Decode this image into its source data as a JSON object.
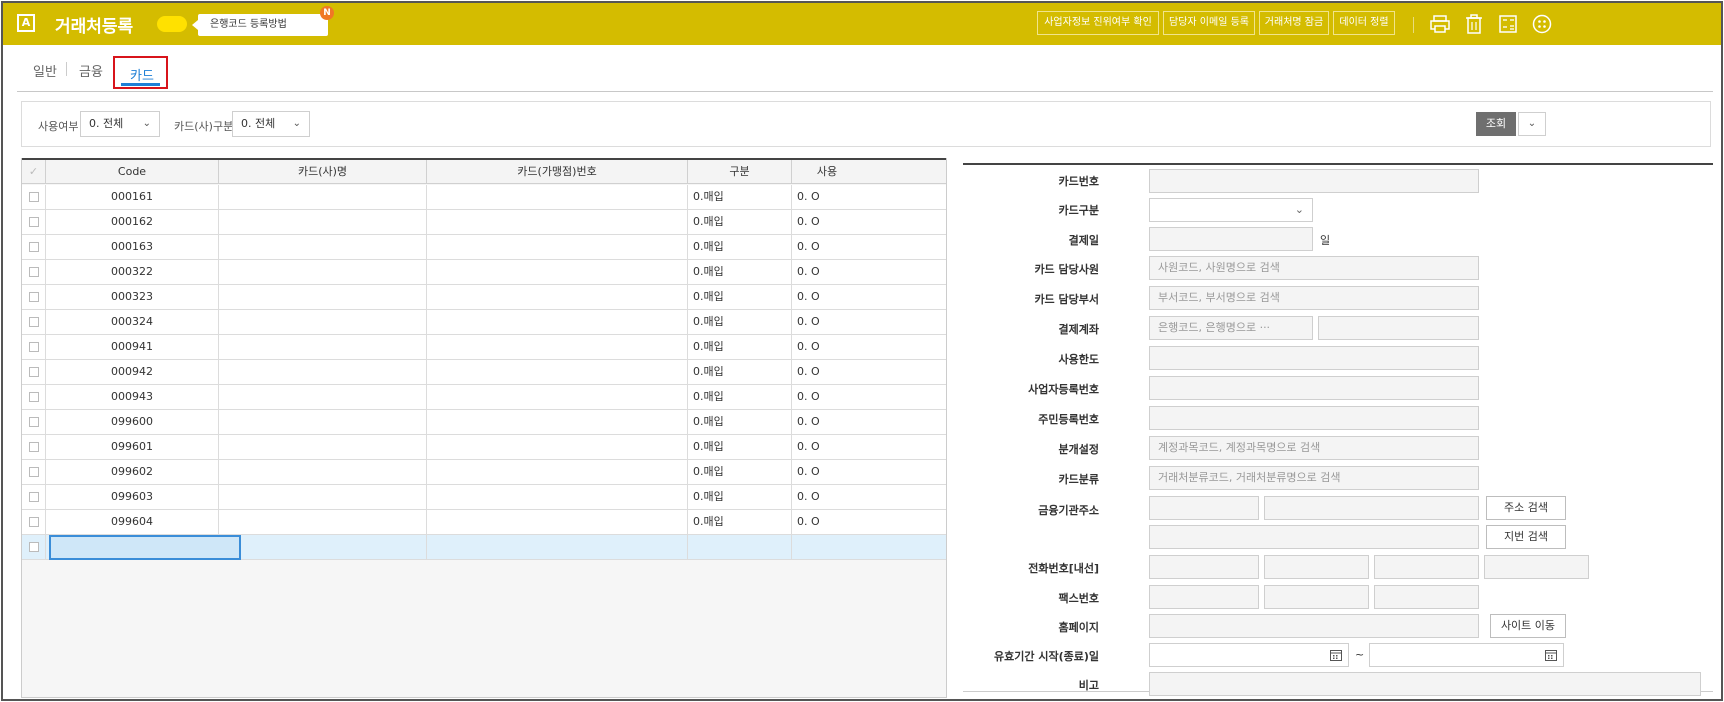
{
  "header": {
    "logo": "A",
    "title": "거래처등록",
    "hint": "은행코드 등록방법",
    "badge": "N",
    "buttons": [
      "사업자정보 진위여부 확인",
      "담당자 이메일 등록",
      "거래처명 잠금",
      "데이터 정렬"
    ],
    "icons": [
      "print-icon",
      "trash-icon",
      "calculator-icon",
      "menu-icon"
    ],
    "accent_color": "#d4bc00"
  },
  "tabs": [
    "일반",
    "금융",
    "카드"
  ],
  "active_tab": "카드",
  "filter": {
    "use_label": "사용여부",
    "use_value": "0. 전체",
    "card_type_label": "카드(사)구분",
    "card_type_value": "0. 전체",
    "search_label": "조회"
  },
  "grid": {
    "columns": [
      "Code",
      "카드(사)명",
      "카드(가맹점)번호",
      "구분",
      "사용"
    ],
    "rows": [
      {
        "code": "000161",
        "name": "",
        "number": "",
        "type": "0.매입",
        "use": "0. O"
      },
      {
        "code": "000162",
        "name": "",
        "number": "",
        "type": "0.매입",
        "use": "0. O"
      },
      {
        "code": "000163",
        "name": "",
        "number": "",
        "type": "0.매입",
        "use": "0. O"
      },
      {
        "code": "000322",
        "name": "",
        "number": "",
        "type": "0.매입",
        "use": "0. O"
      },
      {
        "code": "000323",
        "name": "",
        "number": "",
        "type": "0.매입",
        "use": "0. O"
      },
      {
        "code": "000324",
        "name": "",
        "number": "",
        "type": "0.매입",
        "use": "0. O"
      },
      {
        "code": "000941",
        "name": "",
        "number": "",
        "type": "0.매입",
        "use": "0. O"
      },
      {
        "code": "000942",
        "name": "",
        "number": "",
        "type": "0.매입",
        "use": "0. O"
      },
      {
        "code": "000943",
        "name": "",
        "number": "",
        "type": "0.매입",
        "use": "0. O"
      },
      {
        "code": "099600",
        "name": "",
        "number": "",
        "type": "0.매입",
        "use": "0. O"
      },
      {
        "code": "099601",
        "name": "",
        "number": "",
        "type": "0.매입",
        "use": "0. O"
      },
      {
        "code": "099602",
        "name": "",
        "number": "",
        "type": "0.매입",
        "use": "0. O"
      },
      {
        "code": "099603",
        "name": "",
        "number": "",
        "type": "0.매입",
        "use": "0. O"
      },
      {
        "code": "099604",
        "name": "",
        "number": "",
        "type": "0.매입",
        "use": "0. O"
      }
    ]
  },
  "form": {
    "card_number": "카드번호",
    "card_type": "카드구분",
    "pay_day": "결제일",
    "pay_day_unit": "일",
    "card_manager": "카드 담당사원",
    "card_manager_placeholder": "사원코드, 사원명으로 검색",
    "card_dept": "카드 담당부서",
    "card_dept_placeholder": "부서코드, 부서명으로 검색",
    "pay_account": "결제계좌",
    "pay_account_placeholder": "은행코드, 은행명으로 ···",
    "limit": "사용한도",
    "biz_no": "사업자등록번호",
    "resident_no": "주민등록번호",
    "journal": "분개설정",
    "journal_placeholder": "계정과목코드, 계정과목명으로 검색",
    "category": "카드분류",
    "category_placeholder": "거래처분류코드, 거래처분류명으로 검색",
    "bank_address": "금융기관주소",
    "address_search": "주소 검색",
    "lot_search": "지번 검색",
    "phone": "전화번호[내선]",
    "fax": "팩스번호",
    "homepage": "홈페이지",
    "site_move": "사이트 이동",
    "validity": "유효기간 시작(종료)일",
    "tilde": "~",
    "note": "비고"
  }
}
